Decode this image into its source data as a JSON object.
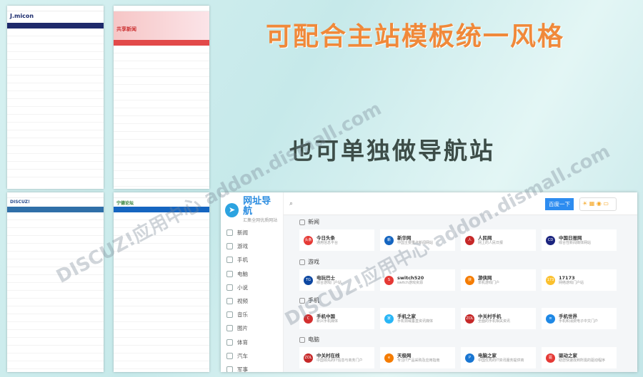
{
  "headline1": "可配合主站模板统一风格",
  "headline2": "也可单独做导航站",
  "watermark": "DISCUZ!应用中心 addon.dismall.com",
  "thumbs": {
    "t1_logo": "J.micon",
    "t2_logo": "共享新闻",
    "t3_logo": "DISCUZ!",
    "t4_logo": "宁德论坛"
  },
  "site": {
    "logo_title": "网址导航",
    "logo_sub": "汇集全网优质网站",
    "search_button": "百度一下",
    "feedback": [
      "申请",
      "收录"
    ]
  },
  "nav": [
    "新闻",
    "游戏",
    "手机",
    "电脑",
    "小说",
    "视频",
    "音乐",
    "图片",
    "体育",
    "汽车",
    "军事"
  ],
  "sections": [
    {
      "title": "新闻",
      "items": [
        {
          "name": "今日头条",
          "desc": "通用信息平台",
          "color": "#e53935",
          "glyph": "头条"
        },
        {
          "name": "新华网",
          "desc": "中国主要重点新闻网站",
          "color": "#1565c0",
          "glyph": "新"
        },
        {
          "name": "人民网",
          "desc": "网上的人民日报",
          "color": "#c62828",
          "glyph": "人"
        },
        {
          "name": "中国日报网",
          "desc": "综合性新闻媒体网站",
          "color": "#1a237e",
          "glyph": "CD"
        }
      ]
    },
    {
      "title": "游戏",
      "items": [
        {
          "name": "电玩巴士",
          "desc": "综合游戏门户站",
          "color": "#0d47a1",
          "glyph": "TG"
        },
        {
          "name": "switch520",
          "desc": "switch游戏资源",
          "color": "#e53935",
          "glyph": "S"
        },
        {
          "name": "游侠网",
          "desc": "单机游戏门户",
          "color": "#f57c00",
          "glyph": "侠"
        },
        {
          "name": "17173",
          "desc": "网络游戏门户站",
          "color": "#fbc02d",
          "glyph": "173"
        }
      ]
    },
    {
      "title": "手机",
      "items": [
        {
          "name": "手机中国",
          "desc": "新兴手机媒体",
          "color": "#d32f2f",
          "glyph": "C"
        },
        {
          "name": "手机之家",
          "desc": "手机领域垂直资讯媒体",
          "color": "#29b6f6",
          "glyph": "家"
        },
        {
          "name": "中关村手机",
          "desc": "全面的手机相关资讯",
          "color": "#c62828",
          "glyph": "ZOL"
        },
        {
          "name": "手机世界",
          "desc": "手机和消费电子中文门户",
          "color": "#1e88e5",
          "glyph": "≡"
        }
      ]
    },
    {
      "title": "电脑",
      "items": [
        {
          "name": "中关村在线",
          "desc": "中国领先的IT信息与商务门户",
          "color": "#c62828",
          "glyph": "ZOL"
        },
        {
          "name": "天极网",
          "desc": "专注IT产品采购及应用指南",
          "color": "#f57c00",
          "glyph": "e"
        },
        {
          "name": "电脑之家",
          "desc": "中国优秀的IT资讯服务提供商",
          "color": "#1976d2",
          "glyph": "P"
        },
        {
          "name": "驱动之家",
          "desc": "助您快速找到所需的驱动程序",
          "color": "#e53935",
          "glyph": "驱"
        }
      ]
    }
  ]
}
